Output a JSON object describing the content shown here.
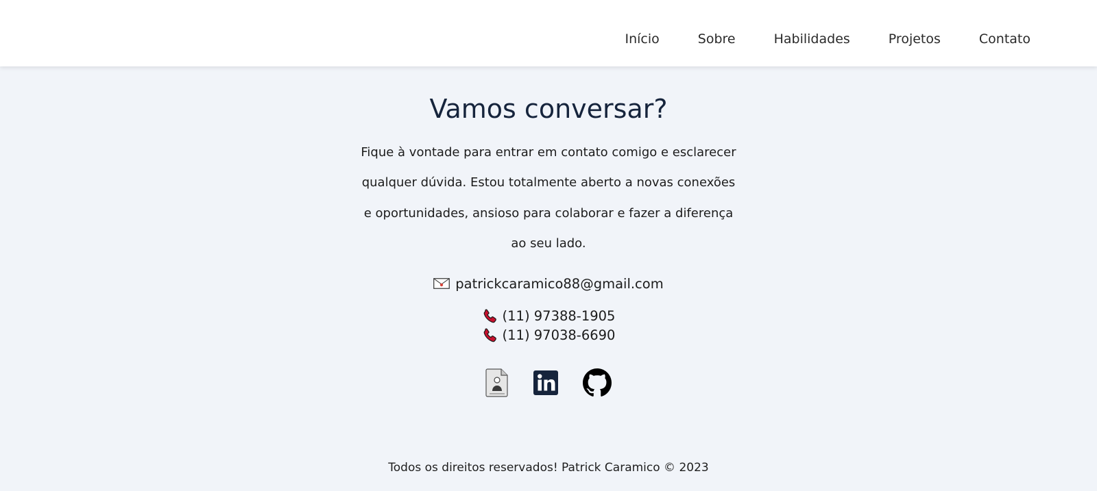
{
  "nav": {
    "items": [
      {
        "label": "Início"
      },
      {
        "label": "Sobre"
      },
      {
        "label": "Habilidades"
      },
      {
        "label": "Projetos"
      },
      {
        "label": "Contato"
      }
    ]
  },
  "contact": {
    "title": "Vamos conversar?",
    "lead": "Fique à vontade para entrar em contato comigo e esclarecer qualquer dúvida. Estou totalmente aberto a novas conexões e oportunidades, ansioso para colaborar e fazer a diferença ao seu lado.",
    "email": "patrickcaramico88@gmail.com",
    "email_icon": "envelope-icon",
    "phone_icon": "telephone-receiver-icon",
    "phones": [
      "(11) 97388-1905",
      "(11) 97038-6690"
    ],
    "socials": [
      {
        "icon": "resume-document-icon"
      },
      {
        "icon": "linkedin-icon"
      },
      {
        "icon": "github-icon"
      }
    ]
  },
  "footer": {
    "text": "Todos os direitos reservados! Patrick Caramico © 2023"
  },
  "colors": {
    "background": "#f1f4f9",
    "navbar": "#ffffff",
    "title": "#16243c",
    "linkedin": "#16243c",
    "phone_icon": "#c8102e"
  }
}
